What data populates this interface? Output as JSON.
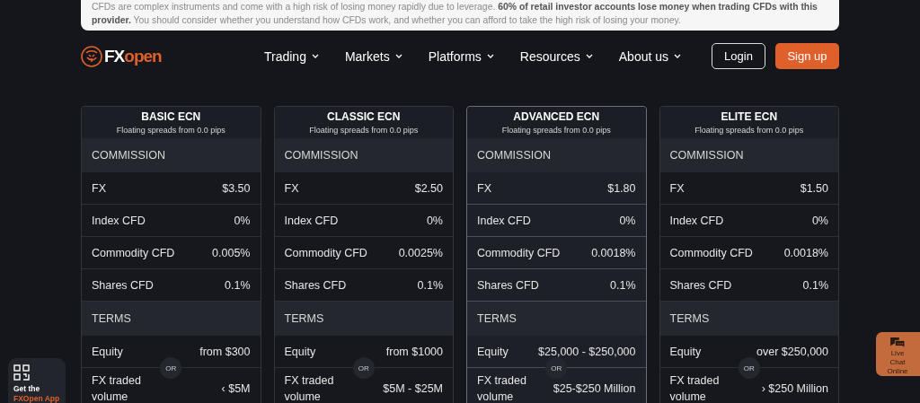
{
  "risk_warning": "CFDs are complex instruments and come with a high risk of losing money rapidly due to leverage. **60% of retail investor accounts lose money when trading CFDs with this provider.** You should consider whether you understand how CFDs work, and whether you can afford to take the high risk of losing your money.",
  "header": {
    "logo": {
      "part_1": "FX",
      "part_2": "open"
    },
    "nav": [
      {
        "label": "Trading"
      },
      {
        "label": "Markets"
      },
      {
        "label": "Platforms"
      },
      {
        "label": "Resources"
      },
      {
        "label": "About us"
      }
    ],
    "login": "Login",
    "signup": "Sign up"
  },
  "plans": [
    {
      "name": "BASIC ECN",
      "subtitle": "Floating spreads from 0.0 pips",
      "highlighted": false,
      "or_label": "OR",
      "sections": [
        {
          "title": "COMMISSION",
          "rows": [
            {
              "label": "FX",
              "value": "$3.50"
            },
            {
              "label": "Index CFD",
              "value": "0%"
            },
            {
              "label": "Commodity CFD",
              "value": "0.005%"
            },
            {
              "label": "Shares CFD",
              "value": "0.1%"
            }
          ]
        },
        {
          "title": "TERMS",
          "rows": [
            {
              "label": "Equity",
              "value": "from $300"
            },
            {
              "label": "FX traded volume",
              "value": "‹ $5M"
            }
          ]
        }
      ]
    },
    {
      "name": "CLASSIC ECN",
      "subtitle": "Floating spreads from 0.0 pips",
      "highlighted": false,
      "or_label": "OR",
      "sections": [
        {
          "title": "COMMISSION",
          "rows": [
            {
              "label": "FX",
              "value": "$2.50"
            },
            {
              "label": "Index CFD",
              "value": "0%"
            },
            {
              "label": "Commodity CFD",
              "value": "0.0025%"
            },
            {
              "label": "Shares CFD",
              "value": "0.1%"
            }
          ]
        },
        {
          "title": "TERMS",
          "rows": [
            {
              "label": "Equity",
              "value": "from $1000"
            },
            {
              "label": "FX traded volume",
              "value": "$5M - $25M"
            }
          ]
        }
      ]
    },
    {
      "name": "ADVANCED ECN",
      "subtitle": "Floating spreads from 0.0 pips",
      "highlighted": true,
      "or_label": "OR",
      "sections": [
        {
          "title": "COMMISSION",
          "rows": [
            {
              "label": "FX",
              "value": "$1.80"
            },
            {
              "label": "Index CFD",
              "value": "0%"
            },
            {
              "label": "Commodity CFD",
              "value": "0.0018%"
            },
            {
              "label": "Shares CFD",
              "value": "0.1%"
            }
          ]
        },
        {
          "title": "TERMS",
          "rows": [
            {
              "label": "Equity",
              "value": "$25,000 - $250,000"
            },
            {
              "label": "FX traded volume",
              "value": "$25-$250 Million"
            }
          ]
        }
      ]
    },
    {
      "name": "ELITE ECN",
      "subtitle": "Floating spreads from 0.0 pips",
      "highlighted": false,
      "or_label": "OR",
      "sections": [
        {
          "title": "COMMISSION",
          "rows": [
            {
              "label": "FX",
              "value": "$1.50"
            },
            {
              "label": "Index CFD",
              "value": "0%"
            },
            {
              "label": "Commodity CFD",
              "value": "0.0018%"
            },
            {
              "label": "Shares CFD",
              "value": "0.1%"
            }
          ]
        },
        {
          "title": "TERMS",
          "rows": [
            {
              "label": "Equity",
              "value": "over $250,000"
            },
            {
              "label": "FX traded volume",
              "value": "› $250 Million"
            }
          ]
        }
      ]
    }
  ],
  "app_promo": {
    "line_1": "Get the",
    "line_2": "FXOpen App"
  },
  "live_chat": "Live Chat Online"
}
